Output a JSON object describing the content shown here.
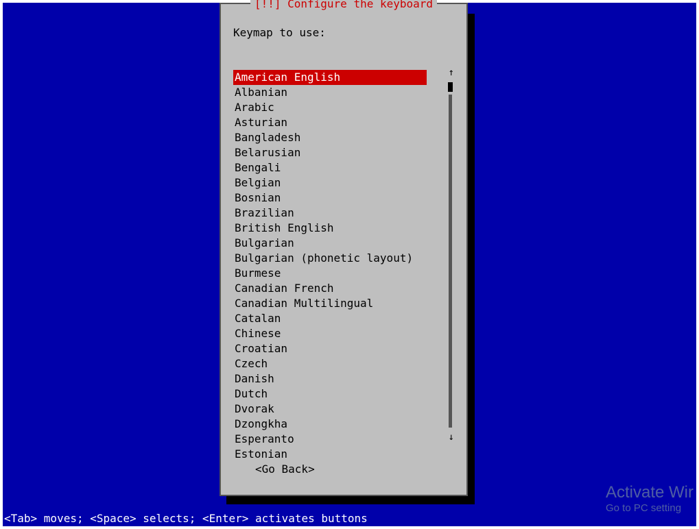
{
  "dialog": {
    "title": "[!!] Configure the keyboard",
    "prompt": "Keymap to use:",
    "go_back": "<Go Back>",
    "selected_index": 0,
    "items": [
      "American English",
      "Albanian",
      "Arabic",
      "Asturian",
      "Bangladesh",
      "Belarusian",
      "Bengali",
      "Belgian",
      "Bosnian",
      "Brazilian",
      "British English",
      "Bulgarian",
      "Bulgarian (phonetic layout)",
      "Burmese",
      "Canadian French",
      "Canadian Multilingual",
      "Catalan",
      "Chinese",
      "Croatian",
      "Czech",
      "Danish",
      "Dutch",
      "Dvorak",
      "Dzongkha",
      "Esperanto",
      "Estonian"
    ]
  },
  "footer": {
    "help": "<Tab> moves; <Space> selects; <Enter> activates buttons"
  },
  "watermark": {
    "title": "Activate Wir",
    "sub": "Go to PC setting"
  },
  "scroll": {
    "up_glyph": "↑",
    "down_glyph": "↓"
  }
}
